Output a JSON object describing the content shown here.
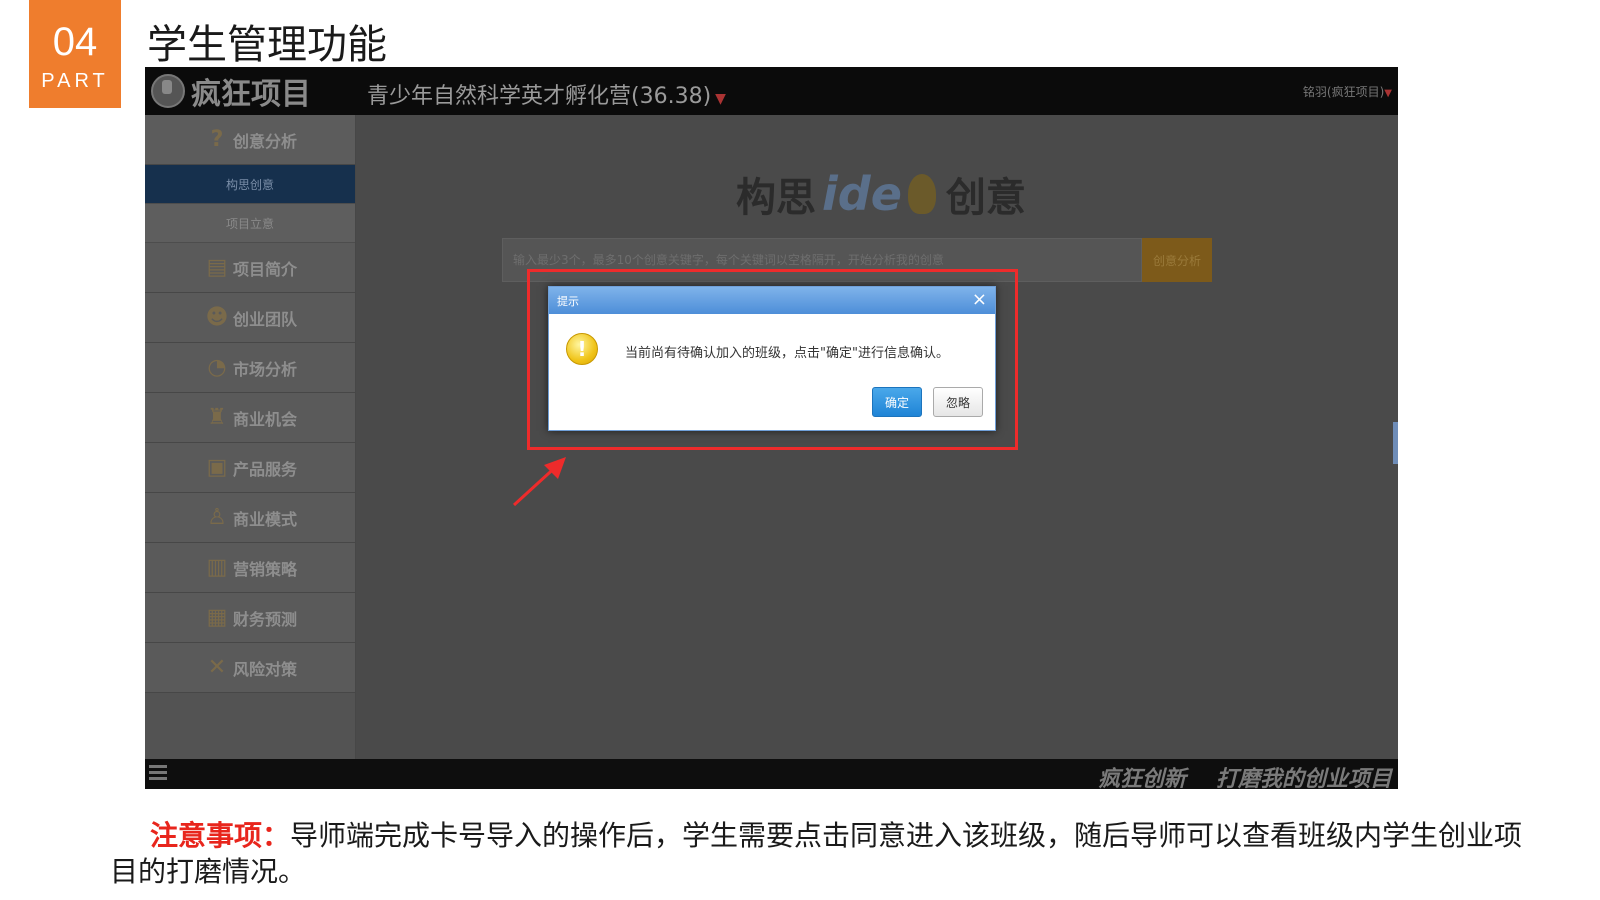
{
  "slide": {
    "part_number": "04",
    "part_word": "PART",
    "title": "学生管理功能"
  },
  "app": {
    "logo_text": "疯狂项目",
    "camp_name": "青少年自然科学英才孵化营(36.38)",
    "user_name": "铭羽(疯狂项目)"
  },
  "sidebar": {
    "group_title": "创意分析",
    "sub_items": [
      {
        "label": "构思创意",
        "active": true
      },
      {
        "label": "项目立意",
        "active": false
      }
    ],
    "items": [
      {
        "label": "项目简介",
        "icon": "document-icon"
      },
      {
        "label": "创业团队",
        "icon": "team-icon"
      },
      {
        "label": "市场分析",
        "icon": "pie-chart-icon"
      },
      {
        "label": "商业机会",
        "icon": "trophy-icon"
      },
      {
        "label": "产品服务",
        "icon": "cart-icon"
      },
      {
        "label": "商业模式",
        "icon": "people-icon"
      },
      {
        "label": "营销策略",
        "icon": "bar-chart-icon"
      },
      {
        "label": "财务预测",
        "icon": "abacus-icon"
      },
      {
        "label": "风险对策",
        "icon": "tools-icon"
      }
    ]
  },
  "main": {
    "brand_left": "构思",
    "brand_mid": "ide",
    "brand_right": "创意",
    "search_placeholder": "输入最少3个，最多10个创意关键字，每个关键词以空格隔开，开始分析我的创意",
    "search_button": "创意分析"
  },
  "footer": {
    "slogan_1": "疯狂创新",
    "slogan_2": "打磨我的创业项目"
  },
  "dialog": {
    "title": "提示",
    "close": "×",
    "warn_glyph": "!",
    "message": "当前尚有待确认加入的班级，点击\"确定\"进行信息确认。",
    "ok_label": "确定",
    "ignore_label": "忽略"
  },
  "note": {
    "label": "注意事项：",
    "text": "导师端完成卡号导入的操作后，学生需要点击同意进入该班级，随后导师可以查看班级内学生创业项目的打磨情况。"
  },
  "colors": {
    "part_orange": "#ef7d2d",
    "highlight_red": "#ee2b2b",
    "dialog_blue": "#4d8ed8",
    "note_label_red": "#e8251c"
  }
}
